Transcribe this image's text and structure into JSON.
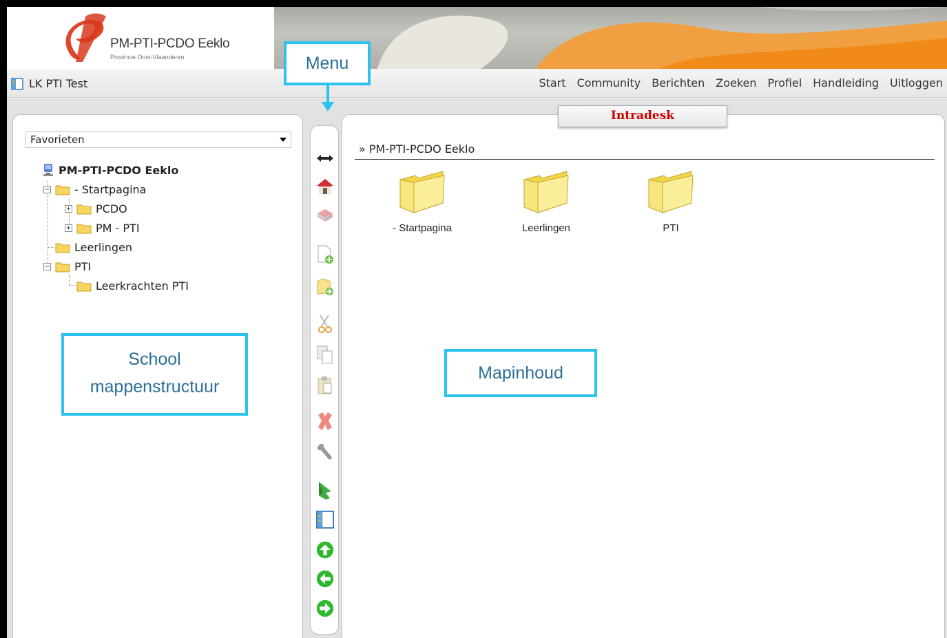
{
  "header": {
    "logo_title": "PM-PTI-PCDO Eeklo",
    "logo_subtitle": "Provincie Oost-Vlaanderen"
  },
  "navbar": {
    "app_title": "LK PTI Test",
    "links": [
      "Start",
      "Community",
      "Berichten",
      "Zoeken",
      "Profiel",
      "Handleiding",
      "Uitloggen"
    ]
  },
  "left_panel": {
    "favorites_select": "Favorieten",
    "tree": {
      "root": "PM-PTI-PCDO Eeklo",
      "items": [
        "- Startpagina",
        "PCDO",
        "PM - PTI",
        "Leerlingen",
        "PTI",
        "Leerkrachten PTI"
      ]
    }
  },
  "right_panel": {
    "tab_title": "Intradesk",
    "breadcrumb": "» PM-PTI-PCDO Eeklo",
    "folders": [
      "- Startpagina",
      "Leerlingen",
      "PTI"
    ]
  },
  "toolbar": {
    "icons": [
      "resize-arrows-icon",
      "home-icon",
      "home-disabled-icon",
      "new-file-icon",
      "new-folder-icon",
      "cut-icon",
      "copy-icon",
      "paste-icon",
      "delete-icon",
      "settings-wrench-icon",
      "bookmark-icon",
      "panel-layout-icon",
      "up-arrow-icon",
      "back-arrow-icon",
      "forward-arrow-icon"
    ]
  },
  "callouts": {
    "menu": "Menu",
    "school_line1": "School",
    "school_line2": "mappenstructuur",
    "mapinhoud": "Mapinhoud"
  },
  "colors": {
    "callout_border": "#29c3f0",
    "callout_text": "#2a6f99",
    "tab_title": "#cc0000",
    "folder_yellow": "#f7e36a",
    "nav_green": "#2eb82e"
  }
}
